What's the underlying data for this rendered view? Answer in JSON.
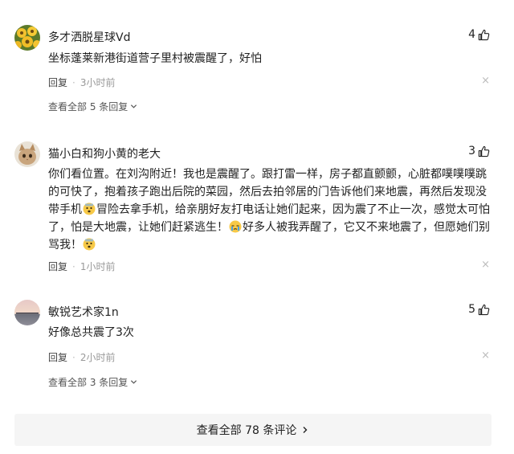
{
  "comments": [
    {
      "username": "多才洒脱星球Vd",
      "likes": "4",
      "lines": [
        "坐标蓬莱新港街道营子里村被震醒了，好怕"
      ],
      "reply_label": "回复",
      "separator": "·",
      "time": "3小时前",
      "view_replies": "查看全部 5 条回复"
    },
    {
      "username": "猫小白和狗小黄的老大",
      "likes": "3",
      "lines": [
        [
          "你们看位置。在刘沟附近！我也是震醒了。跟打雷一样，房子都直颤颤，心脏都噗噗噗跳"
        ],
        [
          "的可快了，抱着孩子跑出后院的菜园，然后去拍邻居的门告诉他们来地震，再然后发现没"
        ],
        [
          "带手机",
          "😨",
          "冒险去拿手机，给亲朋好友打电话让她们起来，因为震了不止一次，感觉太可怕"
        ],
        [
          "了，怕是大地震，让她们赶紧逃生！",
          "😭",
          "好多人被我弄醒了，它又不来地震了，但愿她们别"
        ],
        [
          "骂我！",
          "😨"
        ]
      ],
      "reply_label": "回复",
      "separator": "·",
      "time": "1小时前"
    },
    {
      "username": "敏锐艺术家1n",
      "likes": "5",
      "lines": [
        "好像总共震了3次"
      ],
      "reply_label": "回复",
      "separator": "·",
      "time": "2小时前",
      "view_replies": "查看全部 3 条回复"
    }
  ],
  "close_symbol": "×",
  "footer": {
    "view_all_comments": "查看全部 78 条评论"
  },
  "colors": {
    "text": "#222222",
    "secondary": "#999999",
    "footer_bg": "#f5f5f5"
  },
  "icons": {
    "like": "thumbs-up-icon",
    "close": "close-icon",
    "expand": "chevron-down-icon",
    "more": "chevron-right-icon"
  }
}
